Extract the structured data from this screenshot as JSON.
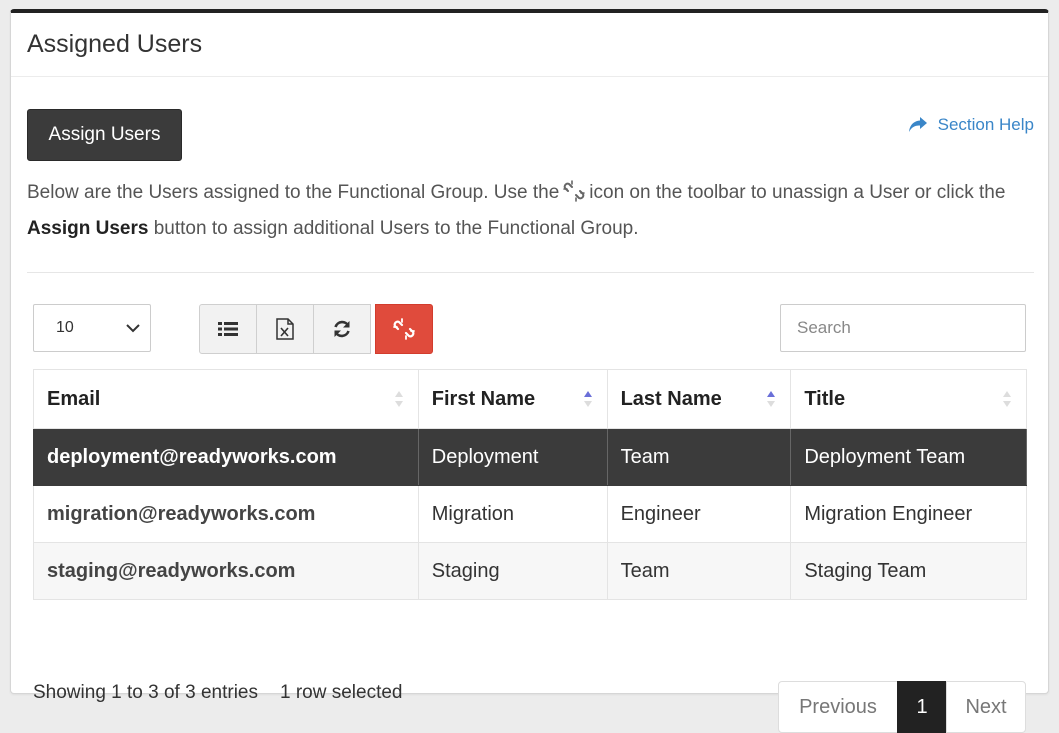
{
  "card": {
    "title": "Assigned Users"
  },
  "actions": {
    "assign_label": "Assign Users",
    "help_label": "Section Help"
  },
  "description": {
    "part1": "Below are the Users assigned to the Functional Group. Use the",
    "part2": "icon on the toolbar to unassign a User or click the",
    "bold": "Assign Users",
    "part3": "button to assign additional Users to the Functional Group."
  },
  "toolbar": {
    "page_size": "10",
    "page_size_options": [
      "10"
    ],
    "search_placeholder": "Search",
    "search_value": "",
    "icons": [
      "list-icon",
      "excel-export-icon",
      "refresh-icon",
      "unlink-icon"
    ]
  },
  "table": {
    "columns": [
      "Email",
      "First Name",
      "Last Name",
      "Title"
    ],
    "rows": [
      {
        "email": "deployment@readyworks.com",
        "first": "Deployment",
        "last": "Team",
        "title": "Deployment Team",
        "selected": true
      },
      {
        "email": "migration@readyworks.com",
        "first": "Migration",
        "last": "Engineer",
        "title": "Migration Engineer",
        "selected": false
      },
      {
        "email": "staging@readyworks.com",
        "first": "Staging",
        "last": "Team",
        "title": "Staging Team",
        "selected": false
      }
    ]
  },
  "footer": {
    "showing": "Showing 1 to 3 of 3 entries",
    "selected": "1 row selected",
    "prev": "Previous",
    "page": "1",
    "next": "Next"
  },
  "colors": {
    "dark": "#3b3b3b",
    "danger": "#e04b3c",
    "link": "#3a86c8",
    "sort_active": "#6a6fd8"
  }
}
